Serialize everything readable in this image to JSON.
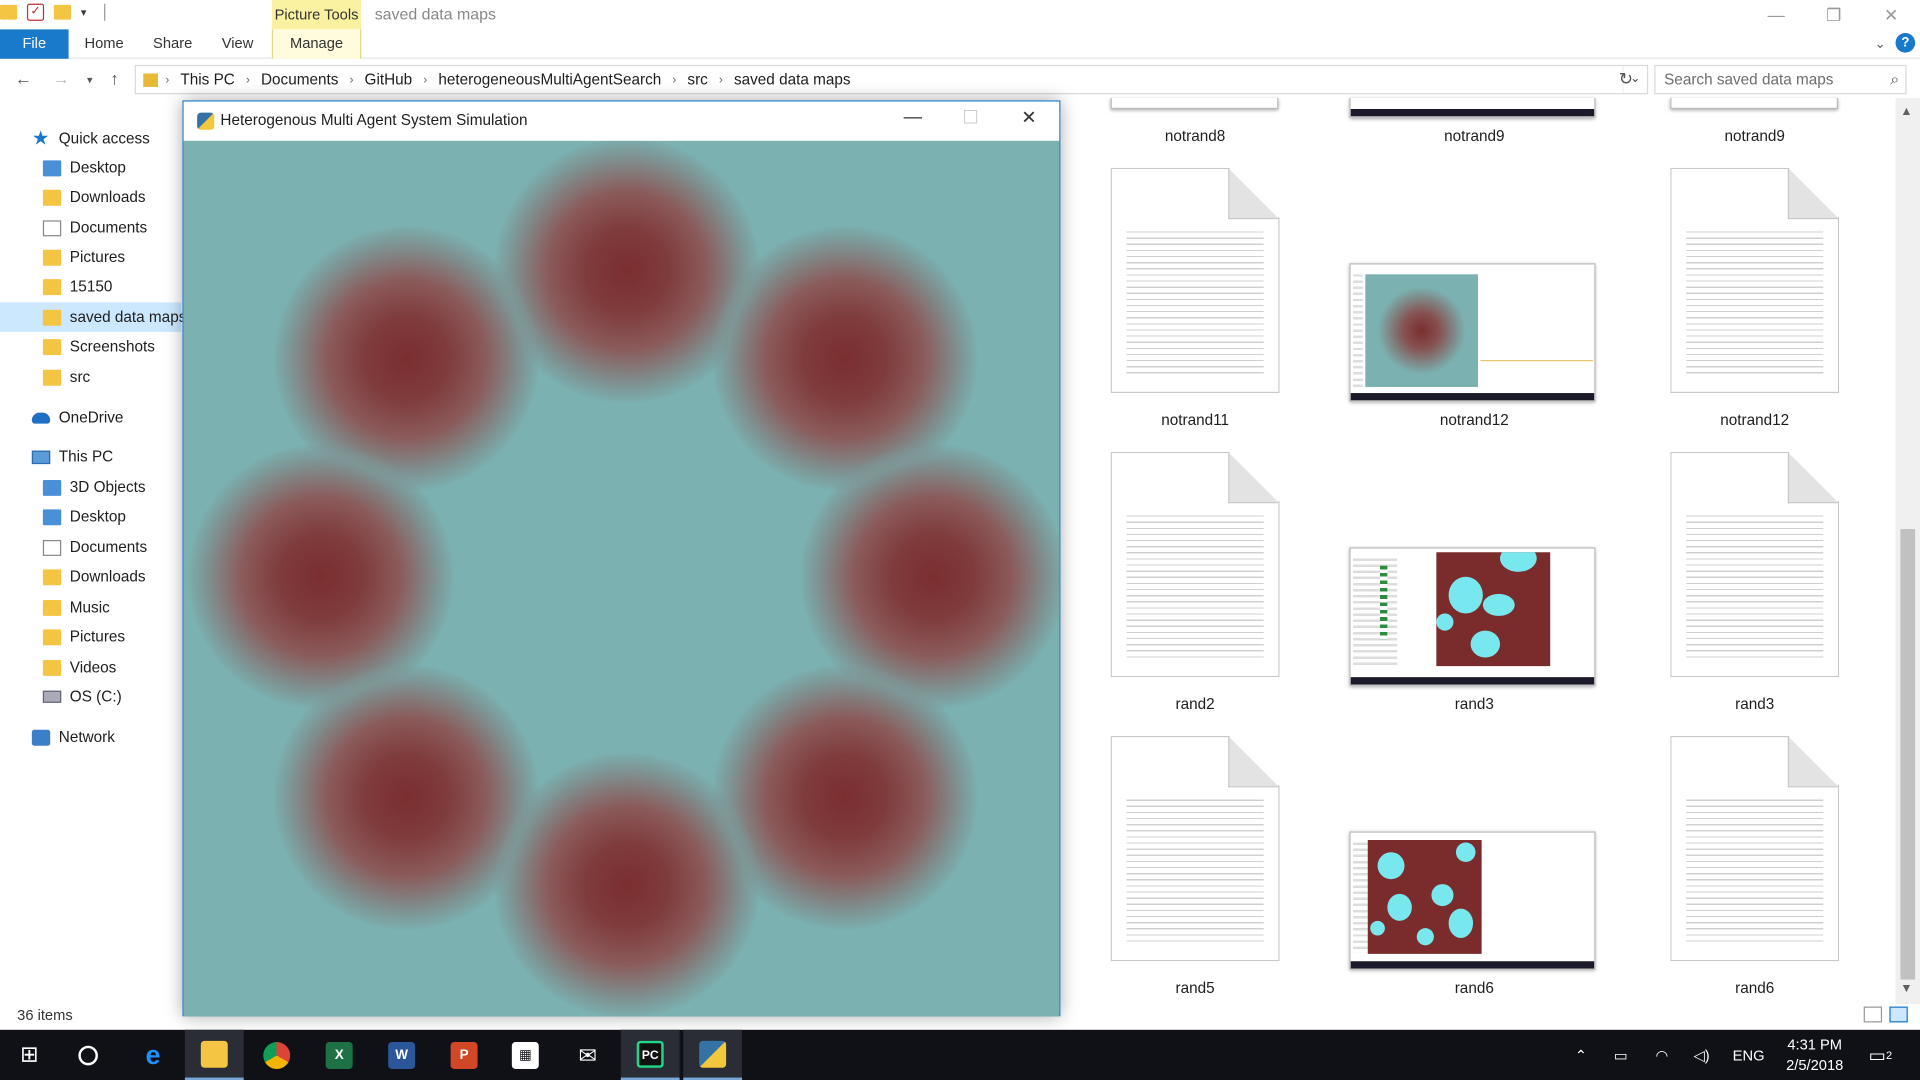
{
  "window": {
    "title": "saved data maps",
    "context_tab_group": "Picture Tools",
    "controls": {
      "minimize": "—",
      "restore": "❐",
      "close": "✕"
    }
  },
  "ribbon": {
    "tabs": [
      {
        "label": "File"
      },
      {
        "label": "Home"
      },
      {
        "label": "Share"
      },
      {
        "label": "View"
      },
      {
        "label": "Manage"
      }
    ]
  },
  "address": {
    "breadcrumbs": [
      "This PC",
      "Documents",
      "GitHub",
      "heterogeneousMultiAgentSearch",
      "src",
      "saved data maps"
    ],
    "search_placeholder": "Search saved data maps"
  },
  "sidebar": {
    "quick_access": "Quick access",
    "quick_items": [
      "Desktop",
      "Downloads",
      "Documents",
      "Pictures",
      "15150",
      "saved data maps",
      "Screenshots",
      "src"
    ],
    "onedrive": "OneDrive",
    "this_pc": "This PC",
    "pc_items": [
      "3D Objects",
      "Desktop",
      "Documents",
      "Downloads",
      "Music",
      "Pictures",
      "Videos",
      "OS (C:)"
    ],
    "network": "Network"
  },
  "files": [
    {
      "name": "notrand8",
      "kind": "doc"
    },
    {
      "name": "notrand9",
      "kind": "screenshot"
    },
    {
      "name": "notrand9",
      "kind": "doc"
    },
    {
      "name": "notrand11",
      "kind": "doc"
    },
    {
      "name": "notrand12",
      "kind": "screenshot"
    },
    {
      "name": "notrand12",
      "kind": "doc"
    },
    {
      "name": "rand2",
      "kind": "doc"
    },
    {
      "name": "rand3",
      "kind": "screenshot"
    },
    {
      "name": "rand3",
      "kind": "doc"
    },
    {
      "name": "rand5",
      "kind": "doc"
    },
    {
      "name": "rand6",
      "kind": "screenshot"
    },
    {
      "name": "rand6",
      "kind": "doc"
    }
  ],
  "status": {
    "item_count": "36 items"
  },
  "simulation": {
    "title": "Heterogenous Multi Agent System Simulation",
    "colors": {
      "background": "#7bb1b1",
      "hotspot": "#7b2e30"
    }
  },
  "taskbar": {
    "apps": [
      "start",
      "cortana",
      "edge",
      "file-explorer",
      "chrome",
      "excel",
      "word",
      "powerpoint",
      "store",
      "mail",
      "pycharm",
      "python"
    ],
    "language": "ENG",
    "time": "4:31 PM",
    "date": "2/5/2018",
    "notifications": "2"
  }
}
